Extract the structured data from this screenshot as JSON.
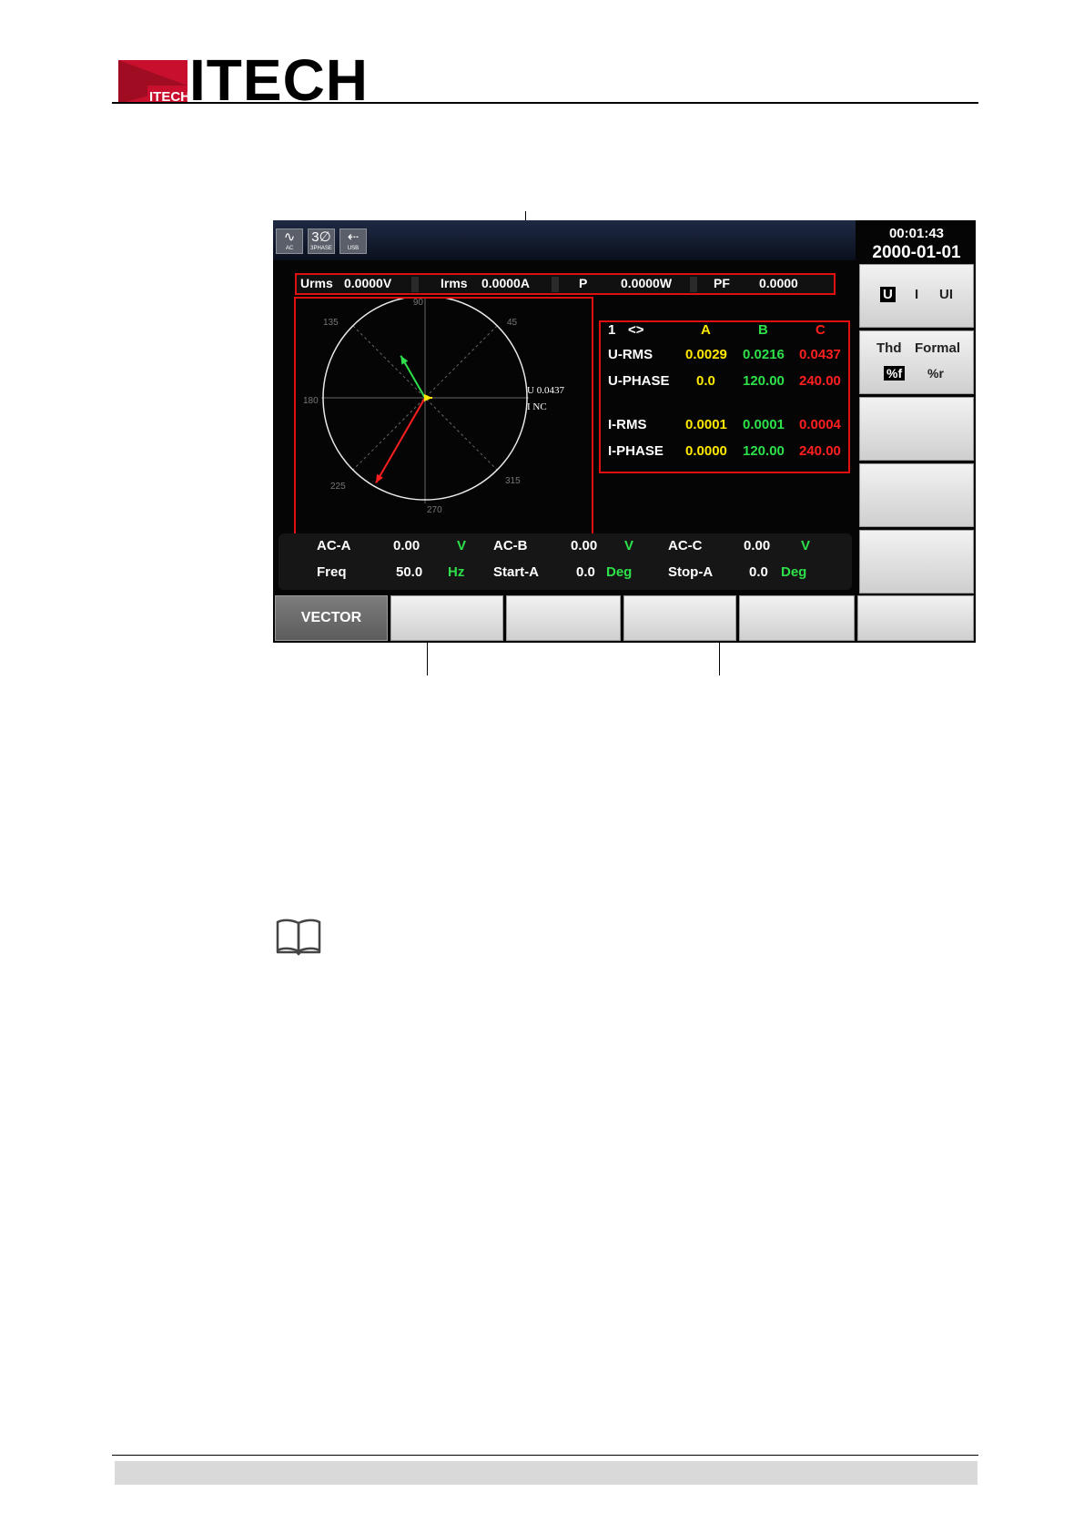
{
  "header": {
    "brand": "ITECH",
    "mark_text": "ITECH"
  },
  "screen": {
    "status_icons": [
      {
        "name": "ac-icon",
        "glyph": "∿",
        "caption": "AC"
      },
      {
        "name": "three-phase-icon",
        "glyph": "3∅",
        "caption": "3PHASE"
      },
      {
        "name": "usb-icon",
        "glyph": "⇠",
        "caption": "USB"
      }
    ],
    "clock": {
      "time": "00:01:43",
      "date": "2000-01-01"
    },
    "measurements": {
      "urms_label": "Urms",
      "urms_value": "0.0000V",
      "irms_label": "Irms",
      "irms_value": "0.0000A",
      "p_label": "P",
      "p_value": "0.0000W",
      "pf_label": "PF",
      "pf_value": "0.0000"
    },
    "vector": {
      "angles": [
        "90",
        "45",
        "135",
        "180",
        "225",
        "270",
        "315"
      ],
      "u_label": "U 0.0437",
      "i_label": "I NC",
      "vectors": [
        {
          "name": "phase-b-vector",
          "angle_deg": 120,
          "magnitude": 0.0216,
          "color": "#2ee04a"
        },
        {
          "name": "phase-c-vector",
          "angle_deg": 240,
          "magnitude": 0.0437,
          "color": "#ff1f1f"
        },
        {
          "name": "phase-a-vector",
          "angle_deg": 0,
          "magnitude": 0.0029,
          "color": "#ffe800"
        }
      ]
    },
    "table": {
      "channel": "1",
      "nav": "<>",
      "col_a": "A",
      "col_b": "B",
      "col_c": "C",
      "rows": [
        {
          "label": "U-RMS",
          "a": "0.0029",
          "b": "0.0216",
          "c": "0.0437"
        },
        {
          "label": "U-PHASE",
          "a": "0.0",
          "b": "120.00",
          "c": "240.00"
        },
        {
          "label": "I-RMS",
          "a": "0.0001",
          "b": "0.0001",
          "c": "0.0004"
        },
        {
          "label": "I-PHASE",
          "a": "0.0000",
          "b": "120.00",
          "c": "240.00"
        }
      ]
    },
    "bottom": {
      "ac_a_label": "AC-A",
      "ac_a_value": "0.00",
      "ac_a_unit": "V",
      "ac_b_label": "AC-B",
      "ac_b_value": "0.00",
      "ac_b_unit": "V",
      "ac_c_label": "AC-C",
      "ac_c_value": "0.00",
      "ac_c_unit": "V",
      "freq_label": "Freq",
      "freq_value": "50.0",
      "freq_unit": "Hz",
      "start_label": "Start-A",
      "start_value": "0.0",
      "start_unit": "Deg",
      "stop_label": "Stop-A",
      "stop_value": "0.0",
      "stop_unit": "Deg"
    },
    "side_buttons": {
      "mode_u": "U",
      "mode_sep": "I",
      "mode_ui": "UI",
      "thd": "Thd",
      "formal": "Formal",
      "pct_f": "%f",
      "pct_r": "%r"
    },
    "soft_buttons": [
      "VECTOR",
      "",
      "",
      "",
      "",
      ""
    ]
  }
}
